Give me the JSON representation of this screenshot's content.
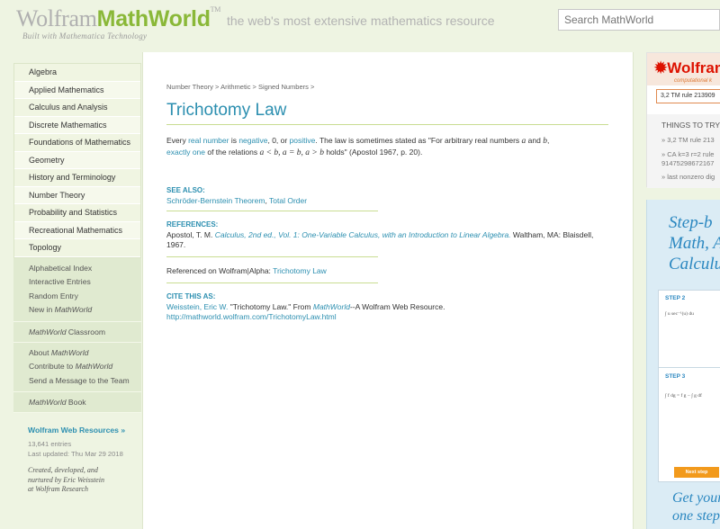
{
  "header": {
    "logo_wolfram": "Wolfram",
    "logo_mathworld": "MathWorld",
    "logo_tm": "TM",
    "logo_sub": "Built with Mathematica Technology",
    "tagline": "the web's most extensive mathematics resource",
    "search_placeholder": "Search MathWorld"
  },
  "nav": {
    "topics": [
      "Algebra",
      "Applied Mathematics",
      "Calculus and Analysis",
      "Discrete Mathematics",
      "Foundations of Mathematics",
      "Geometry",
      "History and Terminology",
      "Number Theory",
      "Probability and Statistics",
      "Recreational Mathematics",
      "Topology"
    ],
    "group1": [
      "Alphabetical Index",
      "Interactive Entries",
      "Random Entry"
    ],
    "new_in": "New in ",
    "mathworld": "MathWorld",
    "classroom": " Classroom",
    "about": "About ",
    "contribute": "Contribute to ",
    "send_message": "Send a Message to the Team",
    "book": " Book",
    "web_resources": "Wolfram Web Resources »",
    "entries": "13,641 entries",
    "updated": "Last updated: Thu Mar 29 2018",
    "credit": [
      "Created, developed, and",
      "nurtured by Eric Weisstein",
      "at Wolfram Research"
    ]
  },
  "breadcrumb": [
    "Number Theory",
    "Arithmetic",
    "Signed Numbers"
  ],
  "breadcrumb_sep": " > ",
  "title": "Trichotomy Law",
  "definition": {
    "t1": "Every ",
    "l1": "real number",
    "t2": " is ",
    "l2": "negative",
    "t3": ", 0, or ",
    "l3": "positive",
    "t4": ". The law is sometimes stated as \"For arbitrary real numbers ",
    "m1": "a",
    "t5": " and ",
    "m2": "b",
    "t6": ",",
    "l4": "exactly one",
    "t7": " of the relations ",
    "m3": "a < b, a = b, a > b",
    "t8": " holds\" (Apostol 1967, p. 20)."
  },
  "see_also": {
    "label": "SEE ALSO:",
    "link1": "Schröder-Bernstein Theorem",
    "sep": ", ",
    "link2": "Total Order"
  },
  "references": {
    "label": "REFERENCES:",
    "author": "Apostol, T. M. ",
    "book": "Calculus, 2nd ed., Vol. 1: One-Variable Calculus, with an Introduction to Linear Algebra.",
    "publisher": " Waltham, MA: Blaisdell,",
    "year": "1967."
  },
  "referenced": {
    "text": "Referenced on Wolfram|Alpha: ",
    "link": "Trichotomy Law"
  },
  "cite": {
    "label": "CITE THIS AS:",
    "author": "Weisstein, Eric W.",
    "t1": " \"Trichotomy Law.\" From ",
    "mw": "MathWorld",
    "t2": "--A Wolfram Web Resource.",
    "url": "http://mathworld.wolfram.com/TrichotomyLaw.html"
  },
  "ad1": {
    "brand": "Wolfram",
    "comp": "computational k",
    "query": "3,2 TM rule 213909",
    "try": "THINGS TO TRY",
    "examples": [
      "» 3,2 TM rule 213",
      "» CA k=3 r=2 rule",
      "91475298672167",
      "» last nonzero dig"
    ]
  },
  "ad2": {
    "head": [
      "Step-b",
      "Math, A",
      "Calculu"
    ],
    "step2": "STEP 2",
    "step3": "STEP 3",
    "next": "Next step",
    "foot": [
      "Get your",
      "one step"
    ]
  },
  "colors": {
    "link": "#2c8fb0",
    "rule": "#c9dd92",
    "brand_green": "#8ab838",
    "wolfram_red": "#dd1100"
  }
}
